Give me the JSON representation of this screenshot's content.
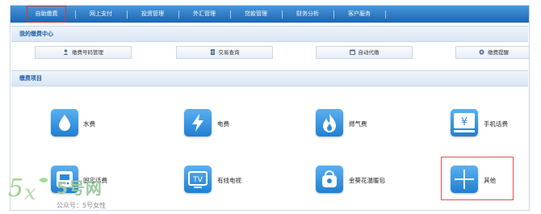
{
  "nav": {
    "items": [
      "自助缴费",
      "网上支付",
      "投资管理",
      "外汇管理",
      "贷款管理",
      "财务分析",
      "客户服务"
    ],
    "active_index": 0
  },
  "center": {
    "title": "我的缴费中心",
    "buttons": [
      {
        "label": "缴费号码管理",
        "icon": "person-icon"
      },
      {
        "label": "交易查询",
        "icon": "document-icon"
      },
      {
        "label": "自动代缴",
        "icon": "calendar-icon"
      },
      {
        "label": "缴费提醒",
        "icon": "gear-icon"
      }
    ]
  },
  "projects": {
    "title": "缴费项目",
    "items": [
      {
        "label": "水费",
        "icon": "water-drop-icon"
      },
      {
        "label": "电费",
        "icon": "lightning-icon"
      },
      {
        "label": "燃气费",
        "icon": "flame-icon"
      },
      {
        "label": "手机话费",
        "icon": "mobile-yen-icon"
      },
      {
        "label": "固定话费",
        "icon": "phone-icon"
      },
      {
        "label": "有线电视",
        "icon": "tv-icon"
      },
      {
        "label": "金葵花温暖包",
        "icon": "bag-icon"
      },
      {
        "label": "其他",
        "icon": "grid-icon"
      }
    ]
  },
  "watermark": {
    "logo_text": "5号网",
    "caption": "公众号：5号女性"
  },
  "colors": {
    "nav": "#2a76c5",
    "tile": "#2b8ad8",
    "section_title": "#1d5fa8",
    "highlight": "#e05151"
  }
}
